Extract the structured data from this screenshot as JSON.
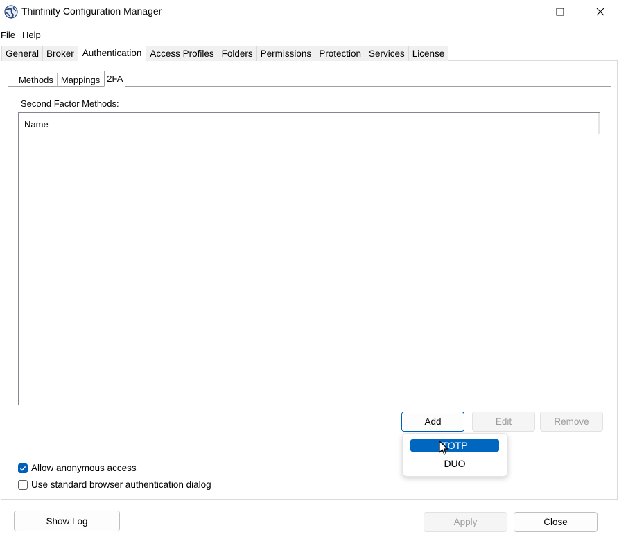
{
  "window": {
    "title": "Thinfinity Configuration Manager"
  },
  "menu": [
    "File",
    "Help"
  ],
  "top_tabs": [
    {
      "label": "General",
      "active": false
    },
    {
      "label": "Broker",
      "active": false
    },
    {
      "label": "Authentication",
      "active": true
    },
    {
      "label": "Access Profiles",
      "active": false
    },
    {
      "label": "Folders",
      "active": false
    },
    {
      "label": "Permissions",
      "active": false
    },
    {
      "label": "Protection",
      "active": false
    },
    {
      "label": "Services",
      "active": false
    },
    {
      "label": "License",
      "active": false
    }
  ],
  "sub_tabs": [
    {
      "label": "Methods",
      "active": false
    },
    {
      "label": "Mappings",
      "active": false
    },
    {
      "label": "2FA",
      "active": true
    }
  ],
  "second_factor": {
    "section_label": "Second Factor Methods:",
    "column_header": "Name",
    "buttons": {
      "add": "Add",
      "edit": "Edit",
      "remove": "Remove"
    },
    "dropdown": {
      "highlighted": "TOTP",
      "items": [
        "TOTP",
        "DUO"
      ]
    }
  },
  "options": {
    "allow_anonymous": {
      "label": "Allow anonymous access",
      "checked": true
    },
    "use_standard_dialog": {
      "label": "Use standard browser authentication dialog",
      "checked": false
    }
  },
  "footer": {
    "show_log": "Show Log",
    "apply": "Apply",
    "close": "Close"
  },
  "colors": {
    "accent": "#005fb8",
    "menu_highlight": "#0067c0",
    "disabled_text": "#9d9d9d"
  }
}
